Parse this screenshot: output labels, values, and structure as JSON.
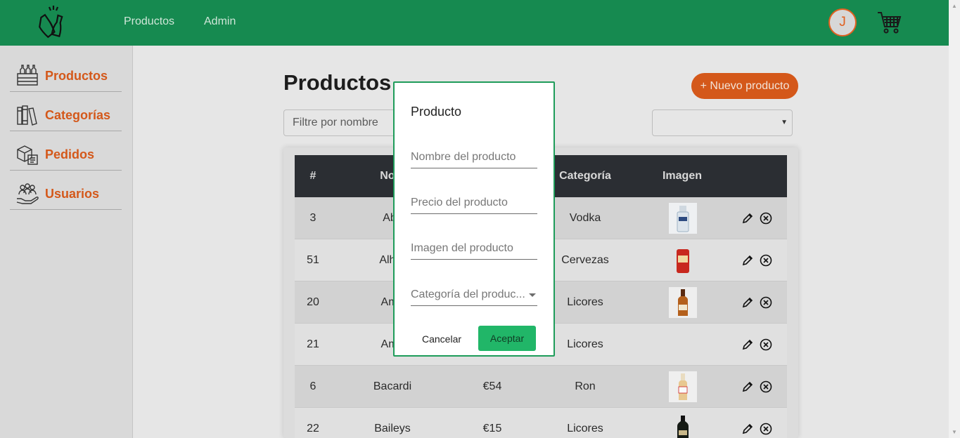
{
  "navbar": {
    "links": [
      "Productos",
      "Admin"
    ],
    "avatar_initial": "J"
  },
  "sidebar": {
    "items": [
      {
        "label": "Productos",
        "icon": "bottles-crate-icon"
      },
      {
        "label": "Categorías",
        "icon": "books-icon"
      },
      {
        "label": "Pedidos",
        "icon": "packages-icon"
      },
      {
        "label": "Usuarios",
        "icon": "users-hand-icon"
      }
    ]
  },
  "main": {
    "title": "Productos",
    "new_button": "+ Nuevo producto",
    "filter_placeholder": "Filtre por nombre",
    "category_select_value": ""
  },
  "table": {
    "headers": [
      "#",
      "Nom",
      "",
      "Categoría",
      "Imagen"
    ],
    "rows": [
      {
        "id": "3",
        "name": "Abs",
        "price": "",
        "category": "Vodka",
        "image": "vodka-bottle"
      },
      {
        "id": "51",
        "name": "Alhar",
        "price": "",
        "category": "Cervezas",
        "image": "beer-can"
      },
      {
        "id": "20",
        "name": "Ama",
        "price": "",
        "category": "Licores",
        "image": "liqueur-bottle"
      },
      {
        "id": "21",
        "name": "Ama",
        "price": "",
        "category": "Licores",
        "image": ""
      },
      {
        "id": "6",
        "name": "Bacardi",
        "price": "€54",
        "category": "Ron",
        "image": "rum-bottle"
      },
      {
        "id": "22",
        "name": "Baileys",
        "price": "€15",
        "category": "Licores",
        "image": "cream-bottle"
      }
    ]
  },
  "modal": {
    "title": "Producto",
    "fields": [
      "Nombre del producto",
      "Precio del producto",
      "Imagen del producto",
      "Categoría del produc..."
    ],
    "cancel": "Cancelar",
    "accept": "Aceptar"
  },
  "colors": {
    "navbar": "#168a50",
    "accent": "#d4581a",
    "accept": "#21b668",
    "table_header": "#2b2e33"
  }
}
